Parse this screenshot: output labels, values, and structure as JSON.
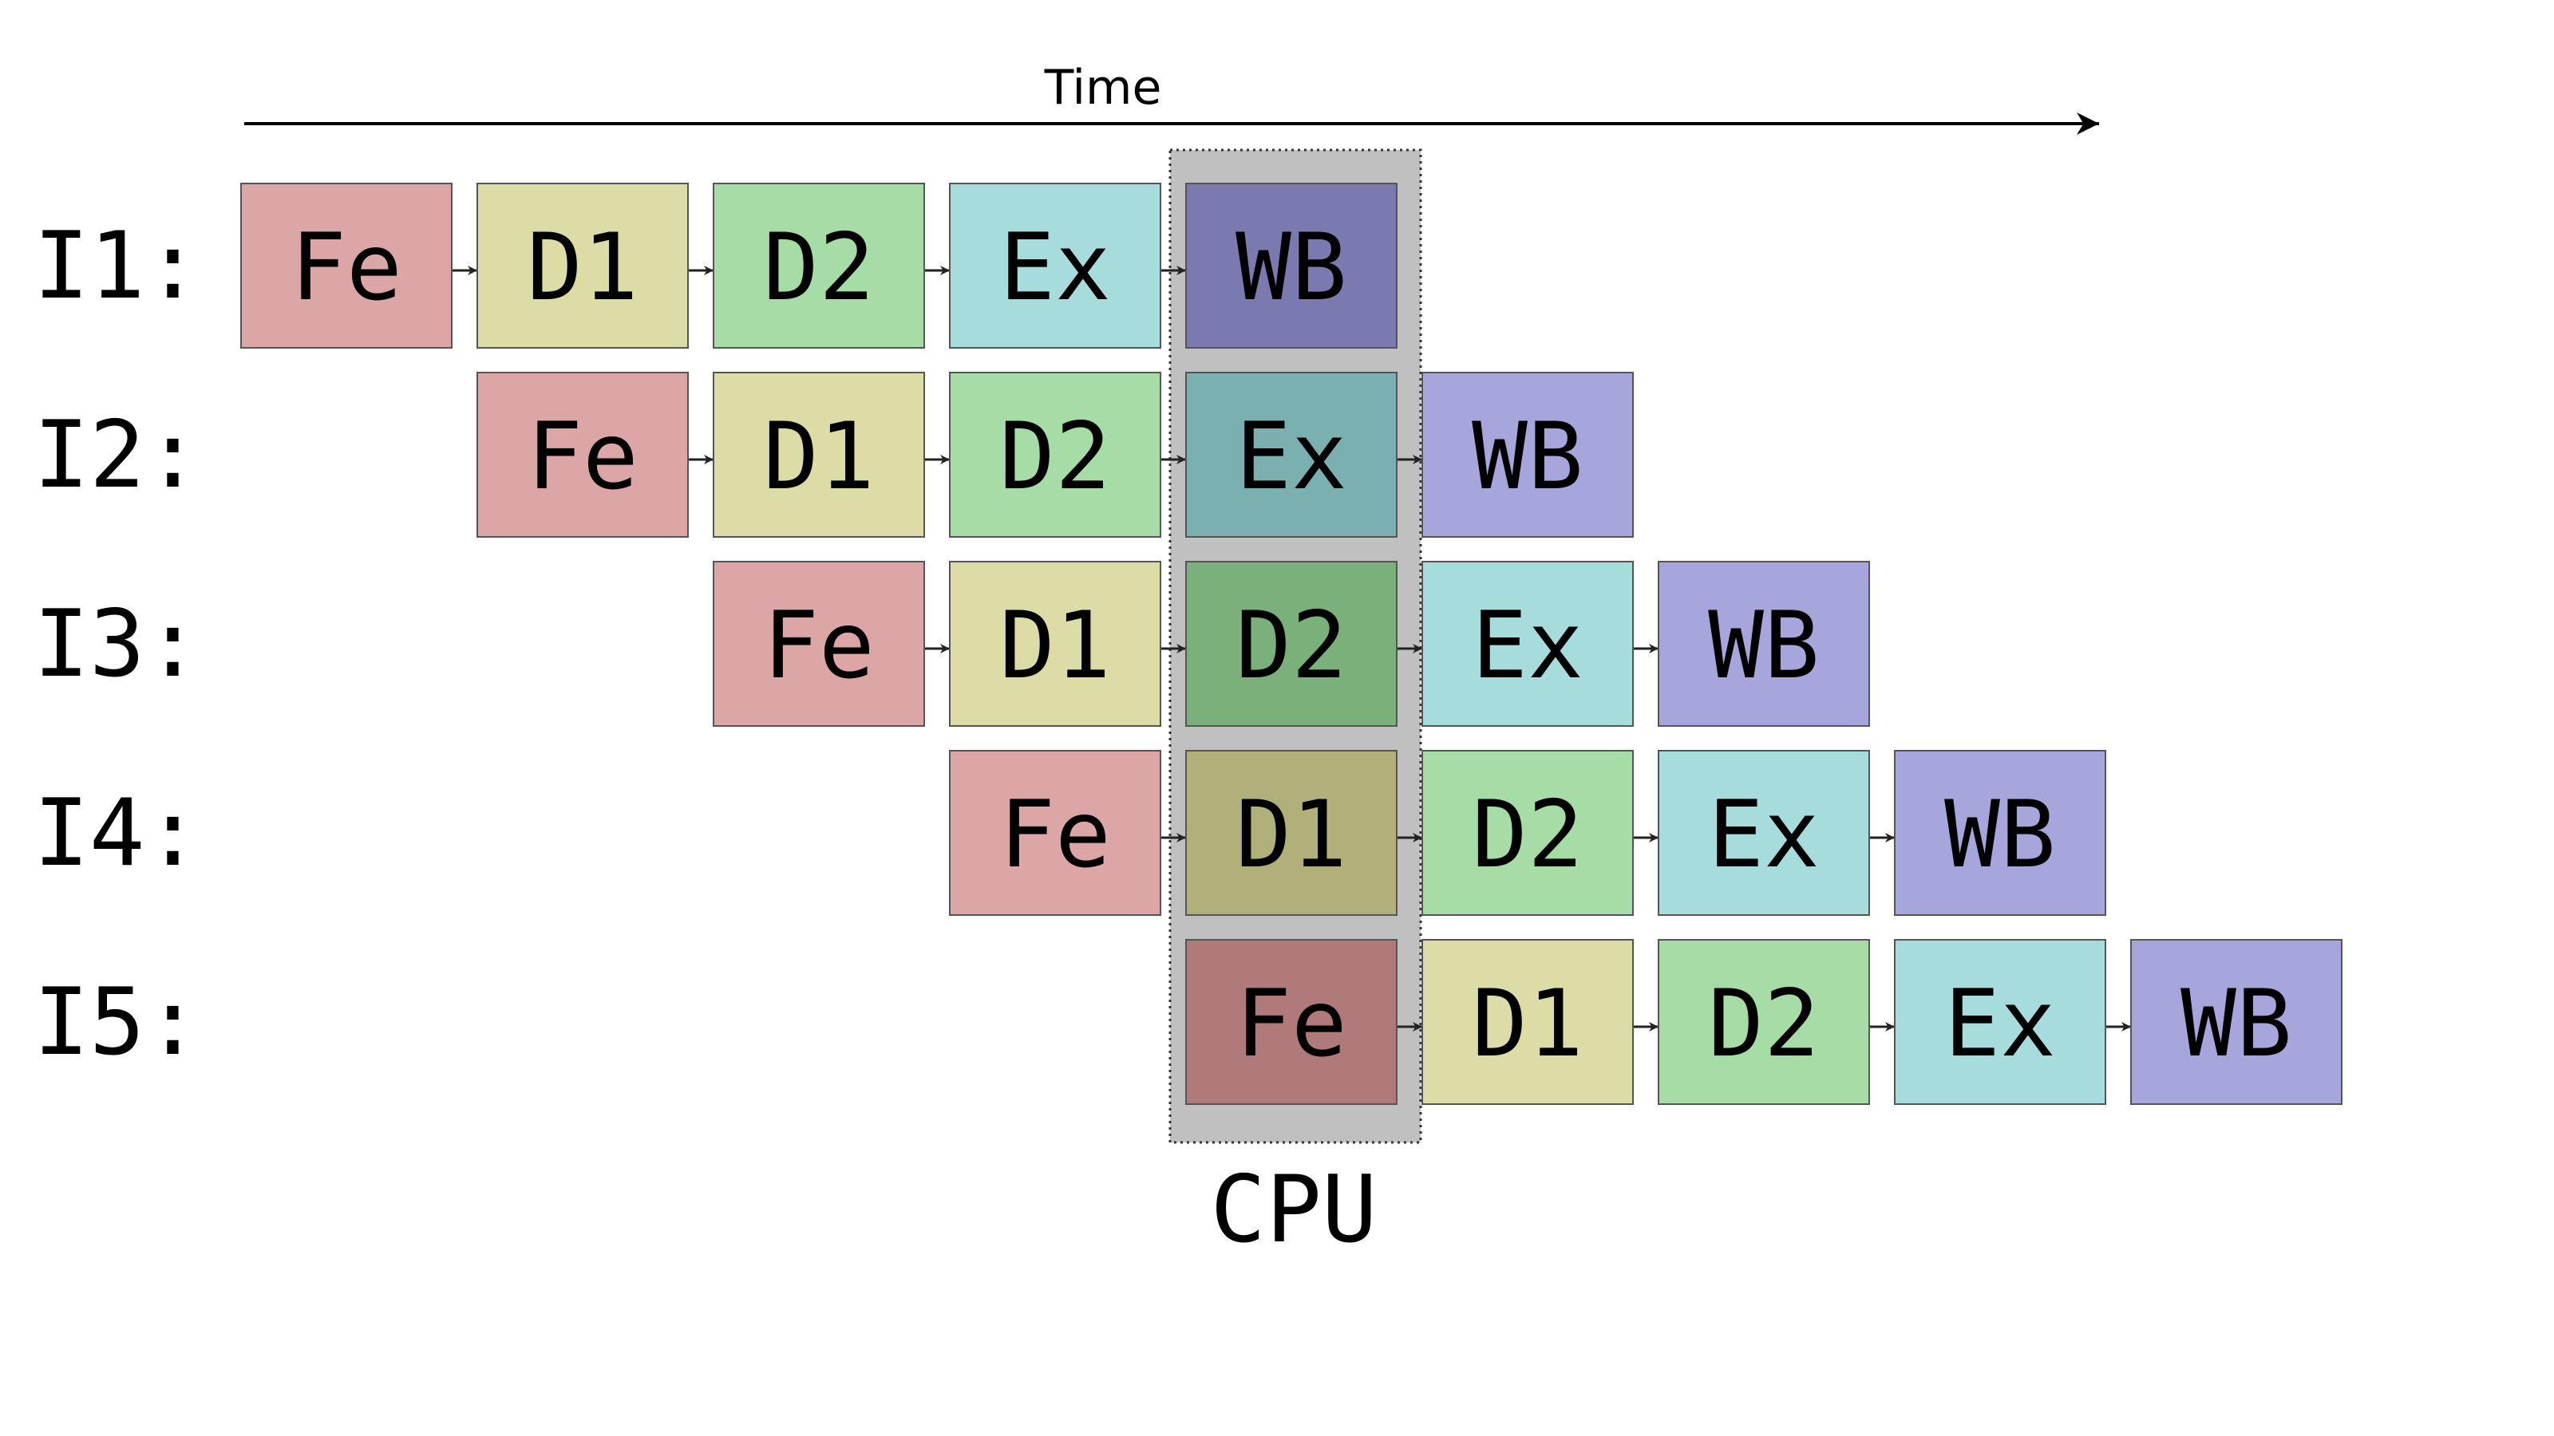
{
  "diagram": {
    "time_label": "Time",
    "cpu_label": "CPU",
    "colors": {
      "Fe": "#dca6a6",
      "D1": "#dcdca6",
      "D2": "#a6dca6",
      "Ex": "#a6dcdc",
      "WB": "#a6a6dc",
      "Fe_active": "#b07a7a",
      "D1_active": "#b0b07a",
      "D2_active": "#7ab07a",
      "Ex_active": "#7ab0b0",
      "WB_active": "#7a7ab0",
      "cpu_band": "#c0c0c0",
      "line": "#000000"
    },
    "instructions": [
      {
        "label": "I1:",
        "start": 0,
        "stages": [
          "Fe",
          "D1",
          "D2",
          "Ex",
          "WB"
        ]
      },
      {
        "label": "I2:",
        "start": 1,
        "stages": [
          "Fe",
          "D1",
          "D2",
          "Ex",
          "WB"
        ]
      },
      {
        "label": "I3:",
        "start": 2,
        "stages": [
          "Fe",
          "D1",
          "D2",
          "Ex",
          "WB"
        ]
      },
      {
        "label": "I4:",
        "start": 3,
        "stages": [
          "Fe",
          "D1",
          "D2",
          "Ex",
          "WB"
        ]
      },
      {
        "label": "I5:",
        "start": 4,
        "stages": [
          "Fe",
          "D1",
          "D2",
          "Ex",
          "WB"
        ]
      }
    ],
    "cpu_column": 4
  }
}
